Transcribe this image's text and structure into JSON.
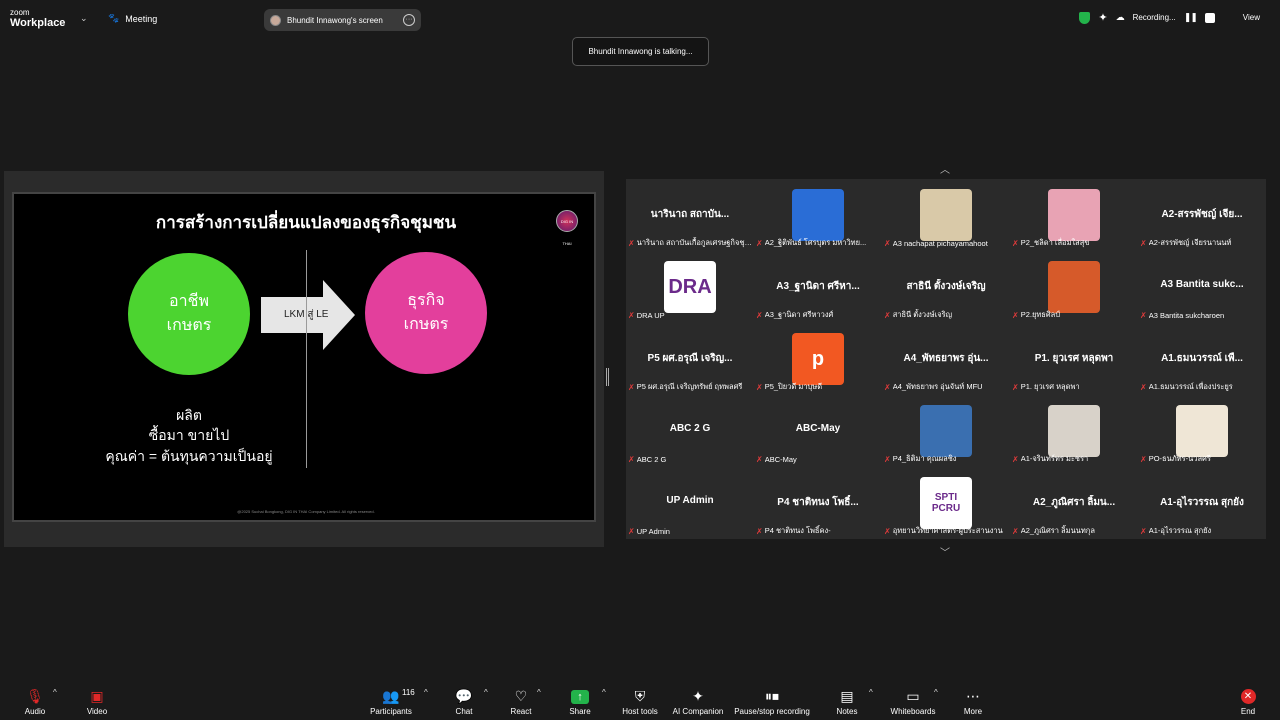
{
  "topbar": {
    "logo_line1": "zoom",
    "logo_line2": "Workplace",
    "meeting_label": "Meeting",
    "screen_label": "Bhundit Innawong's screen",
    "recording_label": "Recording...",
    "view_label": "View"
  },
  "talking": "Bhundit Innawong is talking...",
  "slide": {
    "title": "การสร้างการเปลี่ยนแปลงของธุรกิจชุมชน",
    "logo_text": "DIG IN THAI",
    "left_circle": [
      "อาชีพ",
      "เกษตร"
    ],
    "right_circle": [
      "ธุรกิจ",
      "เกษตร"
    ],
    "arrow_label": "LKM สู่ LE",
    "text_lines": [
      "ผลิต",
      "ซื้อมา ขายไป",
      "คุณค่า = ต้นทุนความเป็นอยู่"
    ],
    "footer": "@2025 Suchai Bongkong, DIG IN THAI Company Limited. All rights reserved."
  },
  "participants": [
    {
      "big": "นารินาถ สถาบัน...",
      "bar": "นารินาถ สถาบันเกื้อกูลเศรษฐกิจชุม..."
    },
    {
      "photo": "#2a6dd6",
      "bar": "A2_ฐิติพันธ์ โศรบุตร มหาวิทย..."
    },
    {
      "photo": "#d9c9a8",
      "bar": "A3 nachapat pichayamahoot"
    },
    {
      "photo": "#e8a3b4",
      "bar": "P2_ชลิดา เลื่อมใสสุข"
    },
    {
      "big": "A2-สรรพัชญ์ เจีย...",
      "bar": "A2-สรรพัชญ์ เจียรนานนท์"
    },
    {
      "photo": "#ffffff",
      "photo_text": "DRA",
      "bar": "DRA UP"
    },
    {
      "big": "A3_ฐานิดา ศรีหา...",
      "bar": "A3_ฐานิดา ศรีหาวงศ์"
    },
    {
      "big": "สาธินี ตั้งวงษ์เจริญ",
      "bar": "สาธินี ตั้งวงษ์เจริญ"
    },
    {
      "photo": "#d65a2a",
      "bar": "P2.ยุทธศิลป์"
    },
    {
      "big": "A3 Bantita sukc...",
      "bar": "A3 Bantita sukcharoen"
    },
    {
      "big": "P5 ผศ.อรุณี เจริญ...",
      "bar": "P5 ผศ.อรุณี เจริญทรัพย์ ฤทพลศรี"
    },
    {
      "photo": "#f25822",
      "photo_text": "p",
      "bar": "P5_ปิยวดี มาบุษดี"
    },
    {
      "big": "A4_พัทธยาพร อุ่น...",
      "bar": "A4_พัทธยาพร อุ่นจันท์ MFU"
    },
    {
      "big": "P1. ยุวเรศ หลุดพา",
      "bar": "P1. ยุวเรศ หลุดพา"
    },
    {
      "big": "A1.ธมนวรรณ์ เพื...",
      "bar": "A1.ธมนวรรณ์ เพื่องประยูร"
    },
    {
      "big": "ABC 2 G",
      "bar": "ABC 2 G"
    },
    {
      "big": "ABC-May",
      "bar": "ABC-May"
    },
    {
      "photo": "#3a6fb0",
      "bar": "P4_ธิติมา คุณผลชิง"
    },
    {
      "photo": "#d8d2c9",
      "bar": "A1-จรินทร์ทร มะชรา"
    },
    {
      "photo": "#efe6d6",
      "bar": "PO-ธนภัทร-นวลศรี"
    },
    {
      "big": "UP Admin",
      "bar": "UP Admin"
    },
    {
      "big": "P4 ชาติทนง โพธิ์...",
      "bar": "P4 ชาติทนง โพธิ์คง-"
    },
    {
      "photo": "#ffffff",
      "photo_text": "SPTI PCRU",
      "bar": "อุทยานวิทยาศาสตร์-ผู้ประสานงาน"
    },
    {
      "big": "A2_ภูณิศรา ลิ้มน...",
      "bar": "A2_ภูณิศรา ลิ้มนนทกุล"
    },
    {
      "big": "A1-อุไรวรรณ สุกยัง",
      "bar": "A1-อุไรวรรณ สุกยัง"
    }
  ],
  "toolbar": {
    "audio": "Audio",
    "video": "Video",
    "participants": "Participants",
    "participants_count": "116",
    "chat": "Chat",
    "react": "React",
    "share": "Share",
    "host_tools": "Host tools",
    "ai_companion": "AI Companion",
    "pause_recording": "Pause/stop recording",
    "notes": "Notes",
    "whiteboards": "Whiteboards",
    "more": "More",
    "end": "End"
  },
  "colors": {
    "accent_green": "#4cd430",
    "accent_pink": "#e33f9c",
    "share_green": "#23b34b",
    "end_red": "#e02828",
    "muted_red": "#e23b3b"
  }
}
